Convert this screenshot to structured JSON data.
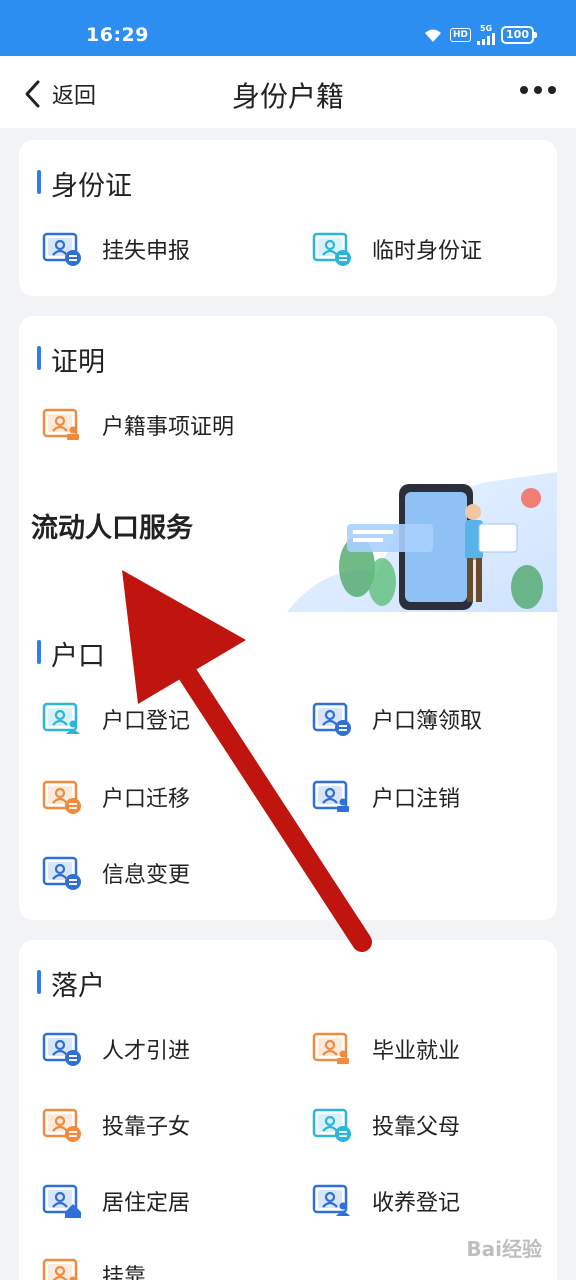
{
  "status": {
    "time": "16:29",
    "hd": "HD",
    "net": "5G",
    "battery": "100"
  },
  "nav": {
    "back_label": "返回",
    "title": "身份户籍"
  },
  "sections": {
    "id_card": {
      "title": "身份证",
      "items": [
        "挂失申报",
        "临时身份证"
      ]
    },
    "proof": {
      "title": "证明",
      "items": [
        "户籍事项证明"
      ]
    },
    "banner": {
      "title": "流动人口服务"
    },
    "hukou": {
      "title": "户口",
      "items": [
        "户口登记",
        "户口簿领取",
        "户口迁移",
        "户口注销",
        "信息变更"
      ]
    },
    "settle": {
      "title": "落户",
      "items": [
        "人才引进",
        "毕业就业",
        "投靠子女",
        "投靠父母",
        "居住定居",
        "收养登记",
        "挂靠"
      ]
    }
  },
  "watermark": "Bai经验",
  "colors": {
    "statusbar": "#2c8ef0",
    "accent": "#2f7de8",
    "icon_blue": "#2f6fd8",
    "icon_cyan": "#2bb5d8",
    "icon_orange": "#f08a3c",
    "arrow": "#c0140e"
  }
}
